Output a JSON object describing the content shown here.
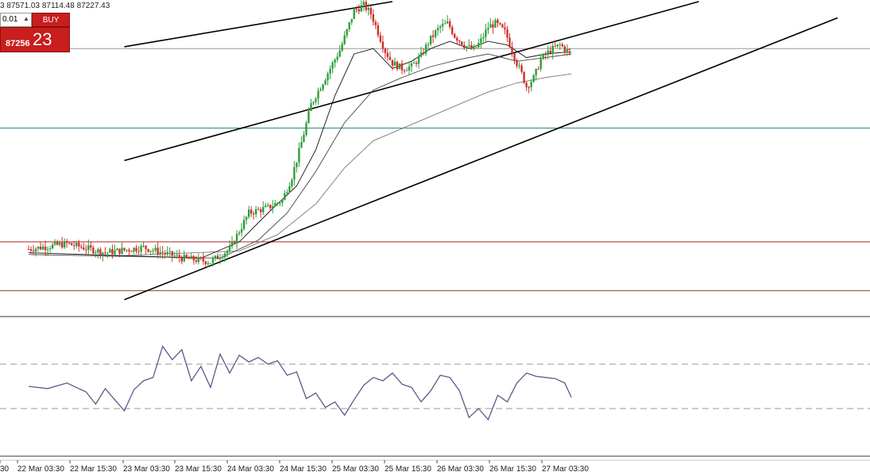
{
  "header": {
    "ohlc_text": "3 87571.03 87114.48 87227.43"
  },
  "trade_panel": {
    "lot_value": "0.01",
    "buy_label": "BUY",
    "price_prefix": "87256",
    "price_big": "23"
  },
  "chart_data": {
    "type": "candlestick",
    "x_ticks": [
      "30",
      "22 Mar 03:30",
      "22 Mar 15:30",
      "23 Mar 03:30",
      "23 Mar 15:30",
      "24 Mar 03:30",
      "24 Mar 15:30",
      "25 Mar 03:30",
      "25 Mar 15:30",
      "26 Mar 03:30",
      "26 Mar 15:30",
      "27 Mar 03:30"
    ],
    "close_path": [
      [
        0,
        86950
      ],
      [
        4,
        86980
      ],
      [
        8,
        86930
      ],
      [
        12,
        86960
      ],
      [
        16,
        86900
      ],
      [
        19,
        86880
      ],
      [
        21,
        86950
      ],
      [
        22,
        87050
      ],
      [
        23,
        87150
      ],
      [
        25,
        87180
      ],
      [
        26.5,
        87220
      ],
      [
        27.5,
        87350
      ],
      [
        28.3,
        87500
      ],
      [
        28.8,
        87600
      ],
      [
        29.5,
        87750
      ],
      [
        30.5,
        87850
      ],
      [
        31.5,
        87950
      ],
      [
        32.5,
        88050
      ],
      [
        33.2,
        88150
      ],
      [
        34,
        88270
      ],
      [
        35,
        88300
      ],
      [
        35.8,
        88250
      ],
      [
        36.5,
        88150
      ],
      [
        37.2,
        88050
      ],
      [
        38,
        87980
      ],
      [
        39,
        87950
      ],
      [
        40,
        87960
      ],
      [
        41,
        88020
      ],
      [
        41.8,
        88100
      ],
      [
        42.5,
        88150
      ],
      [
        43,
        88180
      ],
      [
        43.8,
        88200
      ],
      [
        44.5,
        88130
      ],
      [
        45.5,
        88080
      ],
      [
        46.5,
        88050
      ],
      [
        47.2,
        88100
      ],
      [
        48,
        88180
      ],
      [
        48.8,
        88200
      ],
      [
        49.8,
        88150
      ],
      [
        50.5,
        88050
      ],
      [
        51,
        87980
      ],
      [
        51.5,
        87920
      ],
      [
        52,
        87850
      ],
      [
        52.8,
        87900
      ],
      [
        53.5,
        88000
      ],
      [
        54.5,
        88050
      ],
      [
        55.5,
        88080
      ],
      [
        56.2,
        88050
      ],
      [
        56.7,
        88040
      ]
    ],
    "ma_fast": [
      [
        0,
        86930
      ],
      [
        18,
        86900
      ],
      [
        22,
        86990
      ],
      [
        25,
        87150
      ],
      [
        28,
        87300
      ],
      [
        30,
        87500
      ],
      [
        32,
        87800
      ],
      [
        34,
        88030
      ],
      [
        36,
        88060
      ],
      [
        38,
        87950
      ],
      [
        40,
        87990
      ],
      [
        42,
        88060
      ],
      [
        44,
        88100
      ],
      [
        46,
        88060
      ],
      [
        48,
        88100
      ],
      [
        50,
        88080
      ],
      [
        52,
        88010
      ],
      [
        54,
        88030
      ],
      [
        56,
        88040
      ],
      [
        56.7,
        88040
      ]
    ],
    "ma_mid": [
      [
        0,
        86920
      ],
      [
        20,
        86900
      ],
      [
        24,
        87000
      ],
      [
        27,
        87150
      ],
      [
        30,
        87380
      ],
      [
        33,
        87650
      ],
      [
        36,
        87830
      ],
      [
        39,
        87900
      ],
      [
        42,
        87960
      ],
      [
        45,
        88000
      ],
      [
        48,
        88030
      ],
      [
        51,
        87990
      ],
      [
        54,
        88010
      ],
      [
        56.7,
        88030
      ]
    ],
    "ma_slow": [
      [
        8,
        86910
      ],
      [
        22,
        86940
      ],
      [
        26,
        87030
      ],
      [
        30,
        87200
      ],
      [
        33,
        87400
      ],
      [
        36,
        87550
      ],
      [
        40,
        87640
      ],
      [
        44,
        87730
      ],
      [
        48,
        87820
      ],
      [
        51,
        87870
      ],
      [
        54,
        87900
      ],
      [
        56.7,
        87920
      ]
    ],
    "trendlines": [
      [
        [
          10,
          88070
        ],
        [
          38,
          88320
        ]
      ],
      [
        [
          10,
          87440
        ],
        [
          70,
          88320
        ]
      ],
      [
        [
          10,
          86670
        ],
        [
          84.5,
          88230
        ]
      ]
    ],
    "horizontal_levels": [
      {
        "price": 88060,
        "color": "#9a9a9a"
      },
      {
        "price": 87620,
        "color": "#2a7d8c"
      },
      {
        "price": 86990,
        "color": "#b22222"
      },
      {
        "price": 86720,
        "color": "#8b4513"
      }
    ],
    "price_axis": {
      "min": 86590,
      "max": 88320
    },
    "rsi": {
      "levels": [
        70,
        30
      ],
      "range": [
        0,
        100
      ],
      "path": [
        [
          0,
          50
        ],
        [
          2,
          48
        ],
        [
          4,
          53
        ],
        [
          6,
          45
        ],
        [
          7,
          34
        ],
        [
          8,
          48
        ],
        [
          9,
          38
        ],
        [
          10,
          28
        ],
        [
          11,
          47
        ],
        [
          12,
          55
        ],
        [
          13,
          58
        ],
        [
          14,
          86
        ],
        [
          15,
          74
        ],
        [
          16,
          83
        ],
        [
          17,
          55
        ],
        [
          18,
          68
        ],
        [
          19,
          49
        ],
        [
          20,
          79
        ],
        [
          21,
          62
        ],
        [
          22,
          78
        ],
        [
          23,
          72
        ],
        [
          24,
          76
        ],
        [
          25,
          70
        ],
        [
          26,
          73
        ],
        [
          27,
          60
        ],
        [
          28,
          63
        ],
        [
          29,
          39
        ],
        [
          30,
          44
        ],
        [
          31,
          31
        ],
        [
          32,
          36
        ],
        [
          33,
          24
        ],
        [
          34,
          38
        ],
        [
          35,
          51
        ],
        [
          36,
          58
        ],
        [
          37,
          55
        ],
        [
          38,
          62
        ],
        [
          39,
          52
        ],
        [
          40,
          49
        ],
        [
          41,
          36
        ],
        [
          42,
          46
        ],
        [
          43,
          60
        ],
        [
          44,
          58
        ],
        [
          45,
          46
        ],
        [
          46,
          22
        ],
        [
          47,
          30
        ],
        [
          48,
          20
        ],
        [
          49,
          42
        ],
        [
          50,
          36
        ],
        [
          51,
          53
        ],
        [
          52,
          62
        ],
        [
          53,
          59
        ],
        [
          54,
          58
        ],
        [
          55,
          57
        ],
        [
          56,
          53
        ],
        [
          56.7,
          40
        ]
      ]
    }
  }
}
